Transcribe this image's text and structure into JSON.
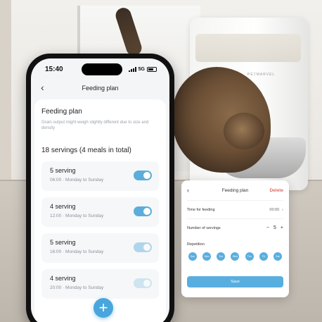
{
  "background": {
    "brand_text": "PETMARVEL"
  },
  "phone": {
    "status": {
      "time": "15:40",
      "network": "5G"
    },
    "header": {
      "back_icon": "chevron-left-icon",
      "title": "Feeding plan"
    },
    "plan": {
      "heading": "Feeding plan",
      "note": "Grain output might weigh slightly different due to size and density",
      "summary": "18 servings (4 meals in total)"
    },
    "meals": [
      {
        "amount": "5 serving",
        "schedule": "06:00 · Monday to Sunday",
        "enabled": true
      },
      {
        "amount": "4 serving",
        "schedule": "12:00 · Monday to Sunday",
        "enabled": true
      },
      {
        "amount": "5 serving",
        "schedule": "16:00 · Monday to Sunday",
        "enabled": true
      },
      {
        "amount": "4 serving",
        "schedule": "20:00 · Monday to Sunday",
        "enabled": true
      }
    ],
    "fab_symbol": "+",
    "colors": {
      "accent": "#48a6dc",
      "toggle_on": "#5cadd9"
    }
  },
  "card": {
    "back_icon": "chevron-left-icon",
    "title": "Feeding plan",
    "delete_label": "Delete",
    "time_label": "Time for feeding",
    "time_value": "00:00",
    "servings_label": "Number of servings",
    "servings_value": "5",
    "minus": "−",
    "plus": "+",
    "repetition_label": "Repetition",
    "days": [
      "Sun",
      "Mon",
      "Tue",
      "Wed",
      "Thu",
      "Fri",
      "Sat"
    ],
    "save_label": "Save",
    "colors": {
      "delete": "#e26b5b",
      "accent": "#59aee0"
    }
  }
}
